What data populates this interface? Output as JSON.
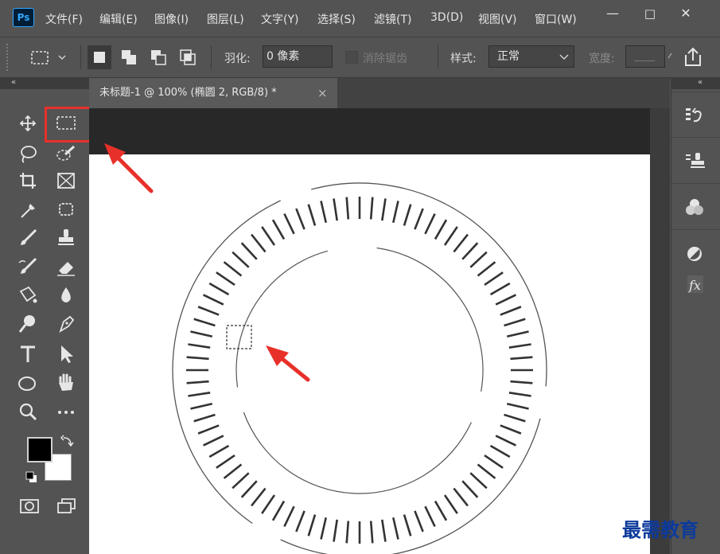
{
  "app": {
    "logo": "Ps"
  },
  "menu": [
    "文件(F)",
    "编辑(E)",
    "图像(I)",
    "图层(L)",
    "文字(Y)",
    "选择(S)",
    "滤镜(T)",
    "3D(D)",
    "视图(V)",
    "窗口(W)"
  ],
  "window_controls": {
    "minimize": "—",
    "maximize": "□",
    "close": "✕"
  },
  "options": {
    "feather_label": "羽化:",
    "feather_value": "0 像素",
    "antialias_label": "消除锯齿",
    "style_label": "样式:",
    "style_value": "正常",
    "width_label": "宽度:"
  },
  "panels": {
    "collapse_left": "«",
    "collapse_right": "«"
  },
  "document": {
    "tab_title": "未标题-1 @ 100% (椭圆 2, RGB/8) *",
    "tab_close": "×"
  },
  "colors": {
    "accent_highlight": "#e8302a",
    "arrow": "#e8302a",
    "ui_background": "#535353",
    "canvas_background": "#ffffff",
    "watermark": "#0c3a9c"
  },
  "watermark": "最需教育"
}
